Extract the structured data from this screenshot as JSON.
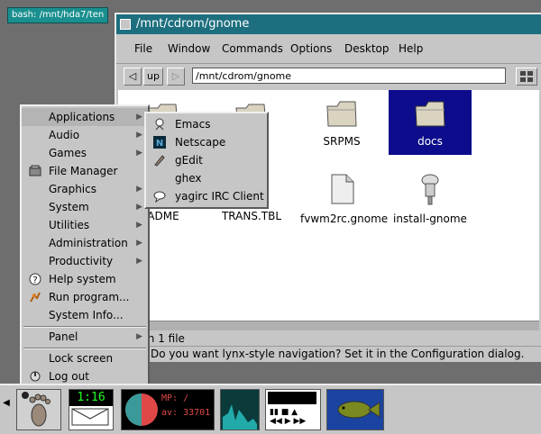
{
  "terminal": {
    "label": "bash: /mnt/hda7/ten"
  },
  "window": {
    "title": "/mnt/cdrom/gnome",
    "menu": [
      "File",
      "Window",
      "Commands",
      "Options",
      "Desktop",
      "Help"
    ],
    "toolbar": {
      "back": "◁",
      "up": "up",
      "forward": "▷",
      "path": "/mnt/cdrom/gnome"
    },
    "files": [
      {
        "name": "SRPMS",
        "icon": "folder-icon"
      },
      {
        "name": "docs",
        "icon": "folder-icon",
        "selected": true
      },
      {
        "name": "ADME",
        "icon": "document-icon"
      },
      {
        "name": "TRANS.TBL",
        "icon": "document-icon"
      },
      {
        "name": "fvwm2rc.gnome",
        "icon": "document-icon"
      },
      {
        "name": "install-gnome",
        "icon": "executable-icon"
      }
    ],
    "status_line1": "es in 1 file",
    "status_line2": "Do you want lynx-style navigation? Set it in the Configuration dialog."
  },
  "main_menu": {
    "items": [
      {
        "label": "Applications",
        "submenu": true
      },
      {
        "label": "Audio",
        "submenu": true
      },
      {
        "label": "Games",
        "submenu": true
      },
      {
        "label": "File Manager",
        "icon": "file-manager-icon"
      },
      {
        "label": "Graphics",
        "submenu": true
      },
      {
        "label": "System",
        "submenu": true
      },
      {
        "label": "Utilities",
        "submenu": true
      },
      {
        "label": "Administration",
        "submenu": true
      },
      {
        "label": "Productivity",
        "submenu": true
      },
      {
        "label": "Help system",
        "icon": "help-icon"
      },
      {
        "label": "Run program...",
        "icon": "run-icon"
      },
      {
        "label": "System Info..."
      },
      {
        "label": "Panel",
        "submenu": true
      },
      {
        "label": "Lock screen"
      },
      {
        "label": "Log out",
        "icon": "logout-icon"
      }
    ]
  },
  "apps_submenu": {
    "items": [
      {
        "label": "Emacs",
        "icon": "emacs-icon"
      },
      {
        "label": "Netscape",
        "icon": "netscape-icon"
      },
      {
        "label": "gEdit",
        "icon": "gedit-icon"
      },
      {
        "label": "ghex"
      },
      {
        "label": "yagirc IRC Client",
        "icon": "irc-icon"
      }
    ]
  },
  "panel": {
    "clock": "1:16",
    "monitor_line1": "MP: /",
    "monitor_line2": "av: 33701"
  }
}
